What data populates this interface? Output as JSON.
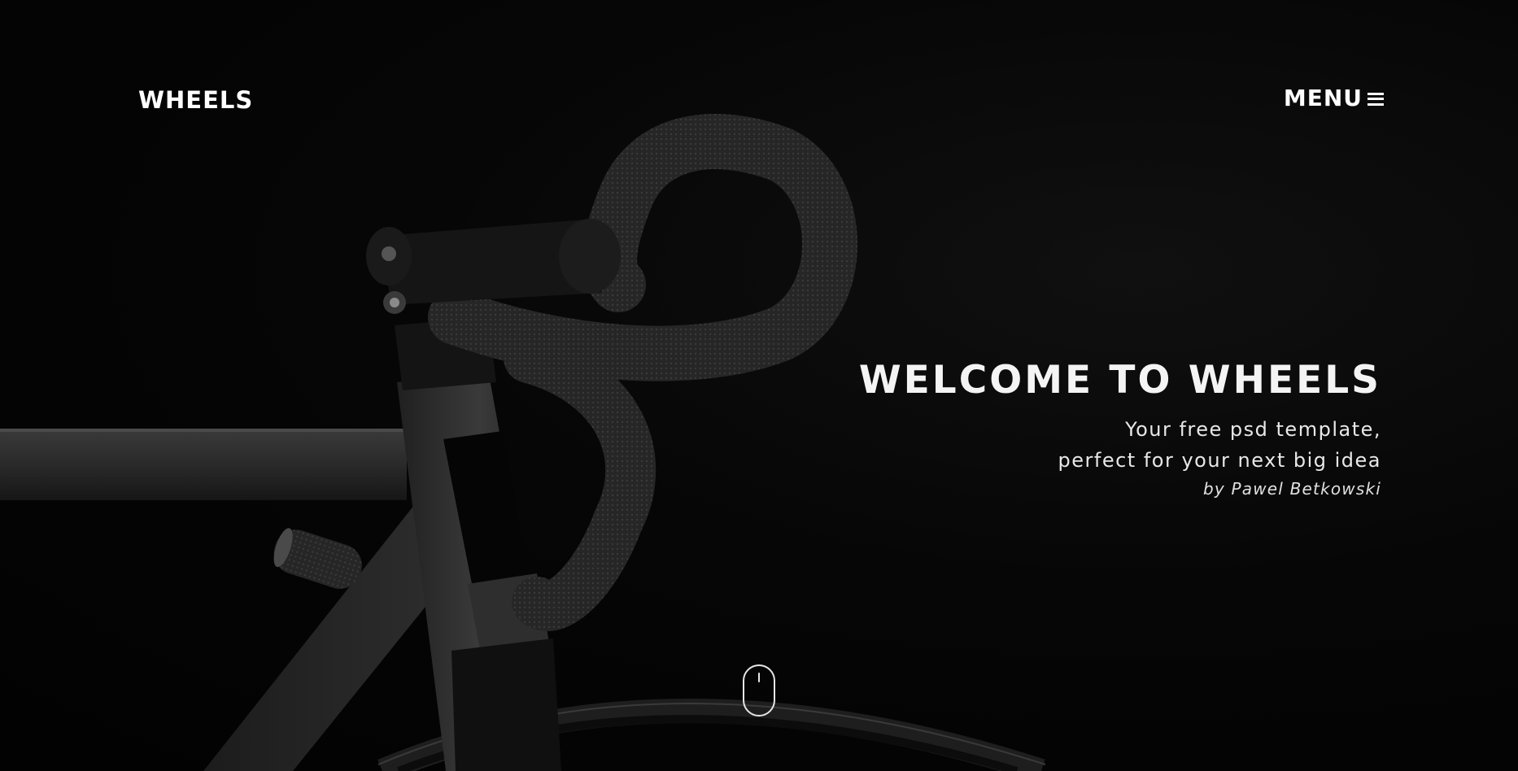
{
  "header": {
    "logo": "WHEELS",
    "menu_label": "MENU",
    "menu_icon": "hamburger-icon"
  },
  "hero": {
    "title": "WELCOME TO WHEELS",
    "subtitle_line1": "Your free psd template,",
    "subtitle_line2": "perfect for your next big idea",
    "byline": "by Pawel Betkowski",
    "background_image": "bicycle-handlebar-photo",
    "scroll_icon": "mouse-scroll-icon"
  },
  "colors": {
    "background": "#050505",
    "text": "#ffffff"
  }
}
